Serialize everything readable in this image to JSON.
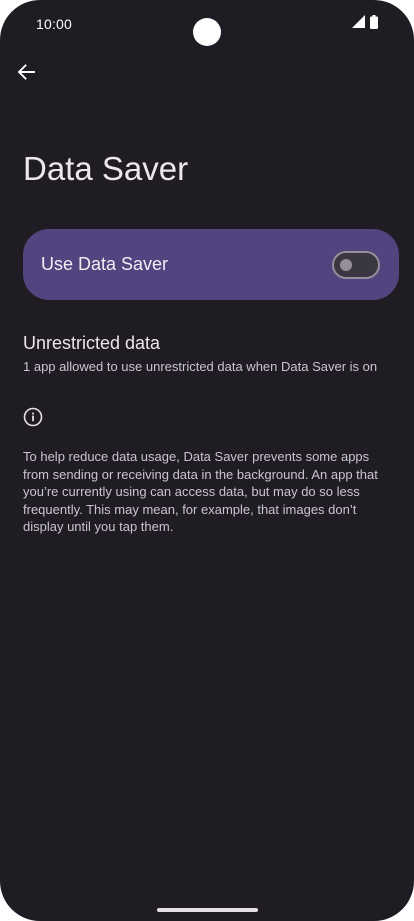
{
  "status_bar": {
    "time": "10:00",
    "icons": [
      "signal-icon",
      "battery-icon"
    ]
  },
  "toolbar": {
    "back_icon": "arrow-back-icon"
  },
  "page": {
    "title": "Data Saver"
  },
  "main_switch": {
    "label": "Use Data Saver",
    "checked": false
  },
  "preferences": [
    {
      "title": "Unrestricted data",
      "summary": "1 app allowed to use unrestricted data when Data Saver is on"
    }
  ],
  "footer": {
    "icon": "info-icon",
    "text": "To help reduce data usage, Data Saver prevents some apps from sending or receiving data in the background. An app that you’re currently using can access data, but may do so less frequently. This may mean, for example, that images don’t display until you tap them."
  },
  "colors": {
    "background": "#1f1d23",
    "switch_bar": "#52457f",
    "text_primary": "#ece6ee",
    "text_secondary": "#cac4d0"
  }
}
